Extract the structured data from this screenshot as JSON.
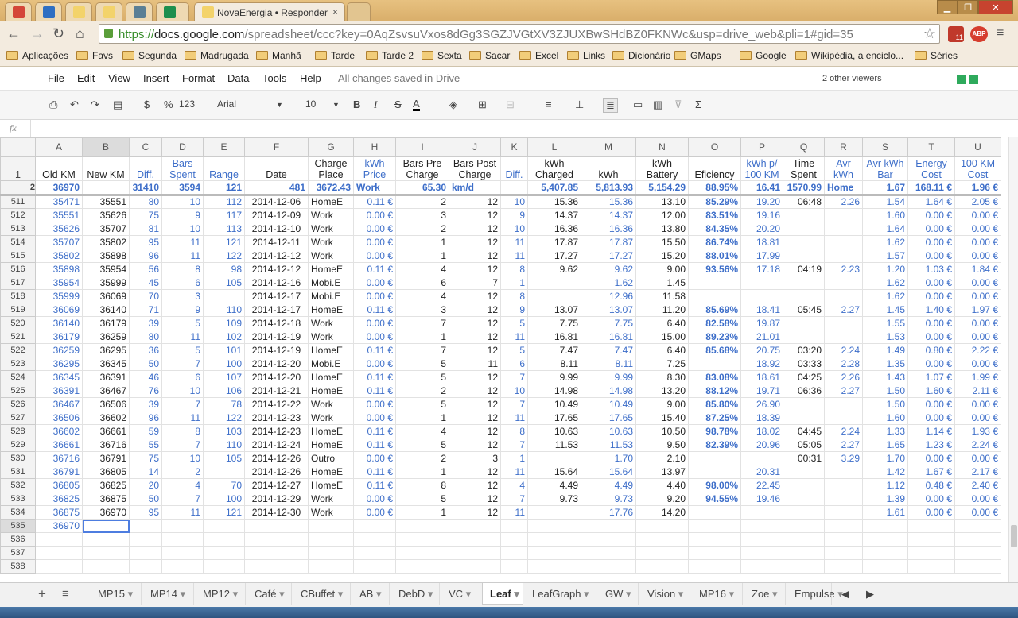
{
  "browser": {
    "tabs": [
      {
        "title": "",
        "color": "#d44638",
        "icon": "gmail-icon"
      },
      {
        "title": "",
        "color": "#2f6fc2",
        "icon": "s-icon"
      },
      {
        "title": "",
        "color": "#f3d36b",
        "icon": "doc-icon"
      },
      {
        "title": "",
        "color": "#f3d36b",
        "icon": "doc-icon"
      },
      {
        "title": "",
        "color": "#5b7f95",
        "icon": "car-icon"
      },
      {
        "title": "",
        "color": "#1d8f4e",
        "icon": "sheets-icon"
      },
      {
        "title": "NovaEnergia • Responder",
        "color": "#f3d36b",
        "icon": "doc-icon",
        "active": true
      }
    ],
    "url_prefix": "https://",
    "url_host": "docs.google.com",
    "url_path": "/spreadsheet/ccc?key=0AqZsvsuVxos8dGg3SGZJVGtXV3ZJUXBwSHdBZ0FKNWc&usp=drive_web&pli=1#gid=35",
    "ext_badge": "11",
    "abp": "ABP",
    "bookmarks": [
      "Aplicações",
      "Favs",
      "Segunda",
      "Madrugada",
      "Manhã",
      "Tarde",
      "Tarde 2",
      "Sexta",
      "Sacar",
      "Excel",
      "Links",
      "Dicionário",
      "GMaps",
      "Google",
      "Wikipédia, a enciclo...",
      "Séries"
    ]
  },
  "menu": {
    "items": [
      "File",
      "Edit",
      "View",
      "Insert",
      "Format",
      "Data",
      "Tools",
      "Help"
    ],
    "status": "All changes saved in Drive",
    "viewers": "2 other viewers"
  },
  "toolbar": {
    "currency": "$",
    "percent": "%",
    "more_formats": "123",
    "font": "Arial",
    "size": "10",
    "bold": "B",
    "italic": "I",
    "strike": "S",
    "textcolor": "A"
  },
  "fx_label": "fx",
  "columns": [
    "A",
    "B",
    "C",
    "D",
    "E",
    "F",
    "G",
    "H",
    "I",
    "J",
    "K",
    "L",
    "M",
    "N",
    "O",
    "P",
    "Q",
    "R",
    "S",
    "T",
    "U"
  ],
  "header1": [
    "Old KM",
    "New KM",
    "Diff.",
    "Bars Spent",
    "Range",
    "Date",
    "Charge Place",
    "kWh Price",
    "Bars Pre Charge",
    "Bars Post Charge",
    "Diff.",
    "kWh Charged",
    "kWh",
    "kWh Battery",
    "Eficiency",
    "kWh p/ 100 KM",
    "Time Spent",
    "Avr kWh",
    "Avr kWh Bar",
    "Energy Cost",
    "100 KM Cost"
  ],
  "header2": [
    "36970",
    "",
    "31410",
    "3594",
    "121",
    "481",
    "3672.43",
    "Work",
    "65.30",
    "km/d",
    "",
    "5,407.85",
    "5,813.93",
    "5,154.29",
    "88.95%",
    "16.41",
    "1570.99",
    "Home",
    "1.67",
    "168.11 €",
    "1.96 €"
  ],
  "rows": [
    {
      "n": "511",
      "c": [
        "35471",
        "35551",
        "80",
        "10",
        "112",
        "2014-12-06",
        "HomeE",
        "0.11 €",
        "2",
        "12",
        "10",
        "15.36",
        "15.36",
        "13.10",
        "85.29%",
        "19.20",
        "06:48",
        "2.26",
        "1.54",
        "1.64 €",
        "2.05 €"
      ]
    },
    {
      "n": "512",
      "c": [
        "35551",
        "35626",
        "75",
        "9",
        "117",
        "2014-12-09",
        "Work",
        "0.00 €",
        "3",
        "12",
        "9",
        "14.37",
        "14.37",
        "12.00",
        "83.51%",
        "19.16",
        "",
        "",
        "1.60",
        "0.00 €",
        "0.00 €"
      ]
    },
    {
      "n": "513",
      "c": [
        "35626",
        "35707",
        "81",
        "10",
        "113",
        "2014-12-10",
        "Work",
        "0.00 €",
        "2",
        "12",
        "10",
        "16.36",
        "16.36",
        "13.80",
        "84.35%",
        "20.20",
        "",
        "",
        "1.64",
        "0.00 €",
        "0.00 €"
      ]
    },
    {
      "n": "514",
      "c": [
        "35707",
        "35802",
        "95",
        "11",
        "121",
        "2014-12-11",
        "Work",
        "0.00 €",
        "1",
        "12",
        "11",
        "17.87",
        "17.87",
        "15.50",
        "86.74%",
        "18.81",
        "",
        "",
        "1.62",
        "0.00 €",
        "0.00 €"
      ]
    },
    {
      "n": "515",
      "c": [
        "35802",
        "35898",
        "96",
        "11",
        "122",
        "2014-12-12",
        "Work",
        "0.00 €",
        "1",
        "12",
        "11",
        "17.27",
        "17.27",
        "15.20",
        "88.01%",
        "17.99",
        "",
        "",
        "1.57",
        "0.00 €",
        "0.00 €"
      ]
    },
    {
      "n": "516",
      "c": [
        "35898",
        "35954",
        "56",
        "8",
        "98",
        "2014-12-12",
        "HomeE",
        "0.11 €",
        "4",
        "12",
        "8",
        "9.62",
        "9.62",
        "9.00",
        "93.56%",
        "17.18",
        "04:19",
        "2.23",
        "1.20",
        "1.03 €",
        "1.84 €"
      ]
    },
    {
      "n": "517",
      "c": [
        "35954",
        "35999",
        "45",
        "6",
        "105",
        "2014-12-16",
        "Mobi.E",
        "0.00 €",
        "6",
        "7",
        "1",
        "",
        "1.62",
        "1.45",
        "",
        "",
        "",
        "",
        "1.62",
        "0.00 €",
        "0.00 €"
      ]
    },
    {
      "n": "518",
      "c": [
        "35999",
        "36069",
        "70",
        "3",
        "",
        "2014-12-17",
        "Mobi.E",
        "0.00 €",
        "4",
        "12",
        "8",
        "",
        "12.96",
        "11.58",
        "",
        "",
        "",
        "",
        "1.62",
        "0.00 €",
        "0.00 €"
      ]
    },
    {
      "n": "519",
      "c": [
        "36069",
        "36140",
        "71",
        "9",
        "110",
        "2014-12-17",
        "HomeE",
        "0.11 €",
        "3",
        "12",
        "9",
        "13.07",
        "13.07",
        "11.20",
        "85.69%",
        "18.41",
        "05:45",
        "2.27",
        "1.45",
        "1.40 €",
        "1.97 €"
      ]
    },
    {
      "n": "520",
      "c": [
        "36140",
        "36179",
        "39",
        "5",
        "109",
        "2014-12-18",
        "Work",
        "0.00 €",
        "7",
        "12",
        "5",
        "7.75",
        "7.75",
        "6.40",
        "82.58%",
        "19.87",
        "",
        "",
        "1.55",
        "0.00 €",
        "0.00 €"
      ]
    },
    {
      "n": "521",
      "c": [
        "36179",
        "36259",
        "80",
        "11",
        "102",
        "2014-12-19",
        "Work",
        "0.00 €",
        "1",
        "12",
        "11",
        "16.81",
        "16.81",
        "15.00",
        "89.23%",
        "21.01",
        "",
        "",
        "1.53",
        "0.00 €",
        "0.00 €"
      ]
    },
    {
      "n": "522",
      "c": [
        "36259",
        "36295",
        "36",
        "5",
        "101",
        "2014-12-19",
        "HomeE",
        "0.11 €",
        "7",
        "12",
        "5",
        "7.47",
        "7.47",
        "6.40",
        "85.68%",
        "20.75",
        "03:20",
        "2.24",
        "1.49",
        "0.80 €",
        "2.22 €"
      ]
    },
    {
      "n": "523",
      "c": [
        "36295",
        "36345",
        "50",
        "7",
        "100",
        "2014-12-20",
        "Mobi.E",
        "0.00 €",
        "5",
        "11",
        "6",
        "8.11",
        "8.11",
        "7.25",
        "",
        "18.92",
        "03:33",
        "2.28",
        "1.35",
        "0.00 €",
        "0.00 €"
      ]
    },
    {
      "n": "524",
      "c": [
        "36345",
        "36391",
        "46",
        "6",
        "107",
        "2014-12-20",
        "HomeE",
        "0.11 €",
        "5",
        "12",
        "7",
        "9.99",
        "9.99",
        "8.30",
        "83.08%",
        "18.61",
        "04:25",
        "2.26",
        "1.43",
        "1.07 €",
        "1.99 €"
      ]
    },
    {
      "n": "525",
      "c": [
        "36391",
        "36467",
        "76",
        "10",
        "106",
        "2014-12-21",
        "HomeE",
        "0.11 €",
        "2",
        "12",
        "10",
        "14.98",
        "14.98",
        "13.20",
        "88.12%",
        "19.71",
        "06:36",
        "2.27",
        "1.50",
        "1.60 €",
        "2.11 €"
      ]
    },
    {
      "n": "526",
      "c": [
        "36467",
        "36506",
        "39",
        "7",
        "78",
        "2014-12-22",
        "Work",
        "0.00 €",
        "5",
        "12",
        "7",
        "10.49",
        "10.49",
        "9.00",
        "85.80%",
        "26.90",
        "",
        "",
        "1.50",
        "0.00 €",
        "0.00 €"
      ]
    },
    {
      "n": "527",
      "c": [
        "36506",
        "36602",
        "96",
        "11",
        "122",
        "2014-12-23",
        "Work",
        "0.00 €",
        "1",
        "12",
        "11",
        "17.65",
        "17.65",
        "15.40",
        "87.25%",
        "18.39",
        "",
        "",
        "1.60",
        "0.00 €",
        "0.00 €"
      ]
    },
    {
      "n": "528",
      "c": [
        "36602",
        "36661",
        "59",
        "8",
        "103",
        "2014-12-23",
        "HomeE",
        "0.11 €",
        "4",
        "12",
        "8",
        "10.63",
        "10.63",
        "10.50",
        "98.78%",
        "18.02",
        "04:45",
        "2.24",
        "1.33",
        "1.14 €",
        "1.93 €"
      ]
    },
    {
      "n": "529",
      "c": [
        "36661",
        "36716",
        "55",
        "7",
        "110",
        "2014-12-24",
        "HomeE",
        "0.11 €",
        "5",
        "12",
        "7",
        "11.53",
        "11.53",
        "9.50",
        "82.39%",
        "20.96",
        "05:05",
        "2.27",
        "1.65",
        "1.23 €",
        "2.24 €"
      ]
    },
    {
      "n": "530",
      "c": [
        "36716",
        "36791",
        "75",
        "10",
        "105",
        "2014-12-26",
        "Outro",
        "0.00 €",
        "2",
        "3",
        "1",
        "",
        "1.70",
        "2.10",
        "",
        "",
        "00:31",
        "3.29",
        "1.70",
        "0.00 €",
        "0.00 €"
      ]
    },
    {
      "n": "531",
      "c": [
        "36791",
        "36805",
        "14",
        "2",
        "",
        "2014-12-26",
        "HomeE",
        "0.11 €",
        "1",
        "12",
        "11",
        "15.64",
        "15.64",
        "13.97",
        "",
        "20.31",
        "",
        "",
        "1.42",
        "1.67 €",
        "2.17 €"
      ]
    },
    {
      "n": "532",
      "c": [
        "36805",
        "36825",
        "20",
        "4",
        "70",
        "2014-12-27",
        "HomeE",
        "0.11 €",
        "8",
        "12",
        "4",
        "4.49",
        "4.49",
        "4.40",
        "98.00%",
        "22.45",
        "",
        "",
        "1.12",
        "0.48 €",
        "2.40 €"
      ]
    },
    {
      "n": "533",
      "c": [
        "36825",
        "36875",
        "50",
        "7",
        "100",
        "2014-12-29",
        "Work",
        "0.00 €",
        "5",
        "12",
        "7",
        "9.73",
        "9.73",
        "9.20",
        "94.55%",
        "19.46",
        "",
        "",
        "1.39",
        "0.00 €",
        "0.00 €"
      ]
    },
    {
      "n": "534",
      "c": [
        "36875",
        "36970",
        "95",
        "11",
        "121",
        "2014-12-30",
        "Work",
        "0.00 €",
        "1",
        "12",
        "11",
        "",
        "17.76",
        "14.20",
        "",
        "",
        "",
        "",
        "1.61",
        "0.00 €",
        "0.00 €"
      ]
    },
    {
      "n": "535",
      "c": [
        "36970",
        "",
        "",
        "",
        "",
        "",
        "",
        "",
        "",
        "",
        "",
        "",
        "",
        "",
        "",
        "",
        "",
        "",
        "",
        "",
        ""
      ]
    },
    {
      "n": "536",
      "c": [
        "",
        "",
        "",
        "",
        "",
        "",
        "",
        "",
        "",
        "",
        "",
        "",
        "",
        "",
        "",
        "",
        "",
        "",
        "",
        "",
        ""
      ]
    },
    {
      "n": "537",
      "c": [
        "",
        "",
        "",
        "",
        "",
        "",
        "",
        "",
        "",
        "",
        "",
        "",
        "",
        "",
        "",
        "",
        "",
        "",
        "",
        "",
        ""
      ]
    },
    {
      "n": "538",
      "c": [
        "",
        "",
        "",
        "",
        "",
        "",
        "",
        "",
        "",
        "",
        "",
        "",
        "",
        "",
        "",
        "",
        "",
        "",
        "",
        "",
        ""
      ]
    }
  ],
  "sheet_tabs": [
    "MP15",
    "MP14",
    "MP12",
    "Café",
    "CBuffet",
    "AB",
    "DebD",
    "VC",
    "Leaf",
    "LeafGraph",
    "GW",
    "Vision",
    "MP16",
    "Zoe",
    "Empulse"
  ],
  "active_sheet": "Leaf"
}
